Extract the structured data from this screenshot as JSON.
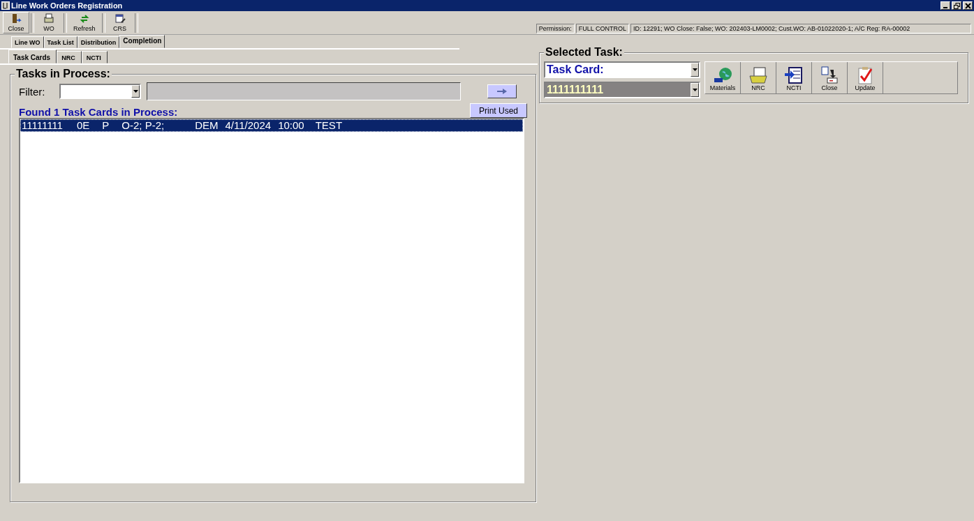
{
  "window": {
    "title": "Line Work Orders Registration"
  },
  "toolbar": [
    {
      "label": "Close",
      "kind": "exit"
    },
    {
      "label": "WO",
      "kind": "wo"
    },
    {
      "label": "Refresh",
      "kind": "refresh"
    },
    {
      "label": "CRS",
      "kind": "crs"
    }
  ],
  "status": {
    "permission_label": "Permission:",
    "permission": "FULL CONTROL",
    "info": "ID: 12291; WO Close: False; WO: 202403-LM0002; Cust.WO: AB-01022020-1; A/C Reg: RA-00002"
  },
  "tabs": [
    {
      "label": "Line WO",
      "selected": false
    },
    {
      "label": "Task List",
      "selected": false
    },
    {
      "label": "Distribution",
      "selected": false
    },
    {
      "label": "Completion",
      "selected": true
    }
  ],
  "subtabs": [
    {
      "label": "Task Cards",
      "selected": true
    },
    {
      "label": "NRC",
      "selected": false
    },
    {
      "label": "NCTI",
      "selected": false
    }
  ],
  "tasks_panel": {
    "title": "Tasks in Process:",
    "filter_label": "Filter:",
    "found_label": "Found 1 Task Cards in Process:",
    "print_button": "Print Used",
    "rows": [
      {
        "selected": true,
        "cells": [
          "11111111",
          "0E",
          "P",
          "O-2; P-2;",
          "DEM",
          "4/11/2024",
          "10:00",
          "TEST"
        ]
      }
    ]
  },
  "selected_task": {
    "title": "Selected Task:",
    "type": "Task Card:",
    "number": "1111111111",
    "actions": [
      {
        "label": "Materials",
        "kind": "globe"
      },
      {
        "label": "NRC",
        "kind": "folder"
      },
      {
        "label": "NCTI",
        "kind": "ncti"
      },
      {
        "label": "Close",
        "kind": "close"
      },
      {
        "label": "Update",
        "kind": "check"
      }
    ]
  }
}
